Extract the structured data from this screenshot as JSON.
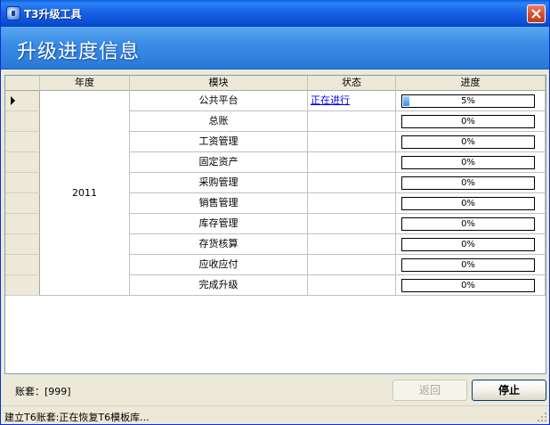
{
  "window": {
    "title": "T3升级工具"
  },
  "banner": {
    "title": "升级进度信息"
  },
  "grid": {
    "columns": [
      "年度",
      "模块",
      "状态",
      "进度"
    ],
    "year": "2011",
    "rows": [
      {
        "module": "公共平台",
        "status": "正在进行",
        "progress": 5,
        "progress_label": "5%"
      },
      {
        "module": "总账",
        "status": "",
        "progress": 0,
        "progress_label": "0%"
      },
      {
        "module": "工资管理",
        "status": "",
        "progress": 0,
        "progress_label": "0%"
      },
      {
        "module": "固定资产",
        "status": "",
        "progress": 0,
        "progress_label": "0%"
      },
      {
        "module": "采购管理",
        "status": "",
        "progress": 0,
        "progress_label": "0%"
      },
      {
        "module": "销售管理",
        "status": "",
        "progress": 0,
        "progress_label": "0%"
      },
      {
        "module": "库存管理",
        "status": "",
        "progress": 0,
        "progress_label": "0%"
      },
      {
        "module": "存货核算",
        "status": "",
        "progress": 0,
        "progress_label": "0%"
      },
      {
        "module": "应收应付",
        "status": "",
        "progress": 0,
        "progress_label": "0%"
      },
      {
        "module": "完成升级",
        "status": "",
        "progress": 0,
        "progress_label": "0%"
      }
    ]
  },
  "footer": {
    "account_label": "账套：[999]",
    "back_label": "返回",
    "stop_label": "停止",
    "status_text": "建立T6账套:正在恢复T6模板库..."
  },
  "colors": {
    "titlebar": "#0a5cdd",
    "banner": "#3a8de6",
    "progress_fill": "#3a90e0",
    "link": "#0000ee"
  }
}
